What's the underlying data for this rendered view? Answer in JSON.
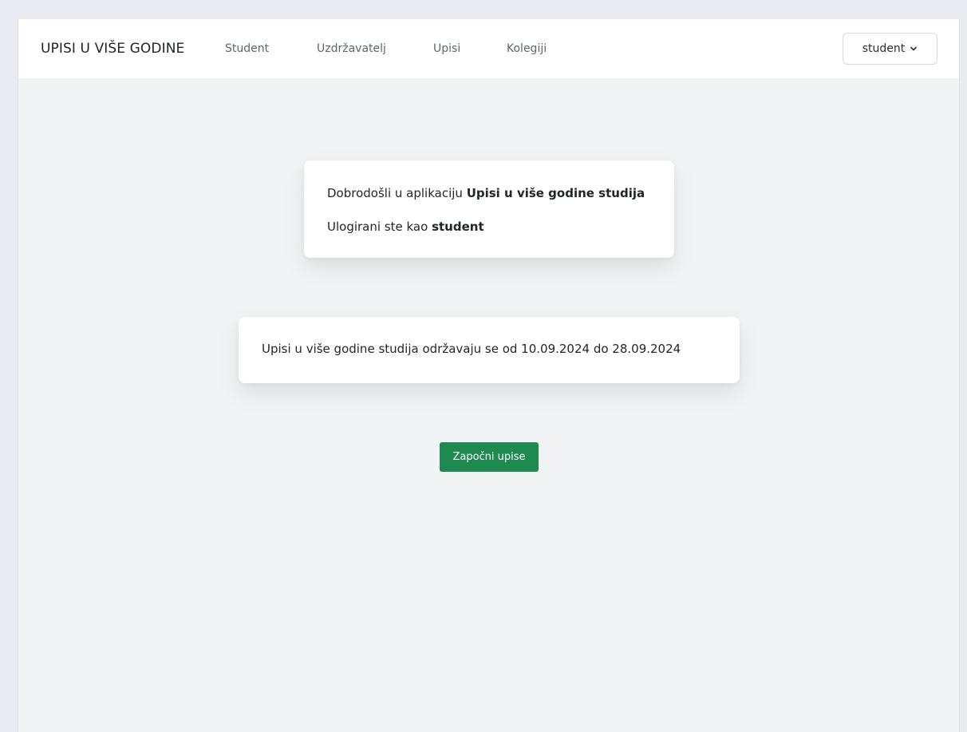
{
  "navbar": {
    "brand": "UPISI U VIŠE GODINE",
    "links": [
      "Student",
      "Uzdržavatelj",
      "Upisi",
      "Kolegiji"
    ],
    "user_menu": {
      "label": "student",
      "icon": "chevron-down-icon"
    }
  },
  "welcome_card": {
    "line1_prefix": "Dobrodošli u aplikaciju ",
    "line1_bold": "Upisi u više godine studija",
    "line2_prefix": "Ulogirani ste kao ",
    "line2_bold": "student"
  },
  "dates_card": {
    "text": "Upisi u više godine studija održavaju se od 10.09.2024 do 28.09.2024"
  },
  "actions": {
    "start_label": "Započni upise"
  },
  "colors": {
    "primary_button": "#1e8a4f",
    "page_background": "#f2f3f5",
    "navbar_background": "#ffffff"
  }
}
